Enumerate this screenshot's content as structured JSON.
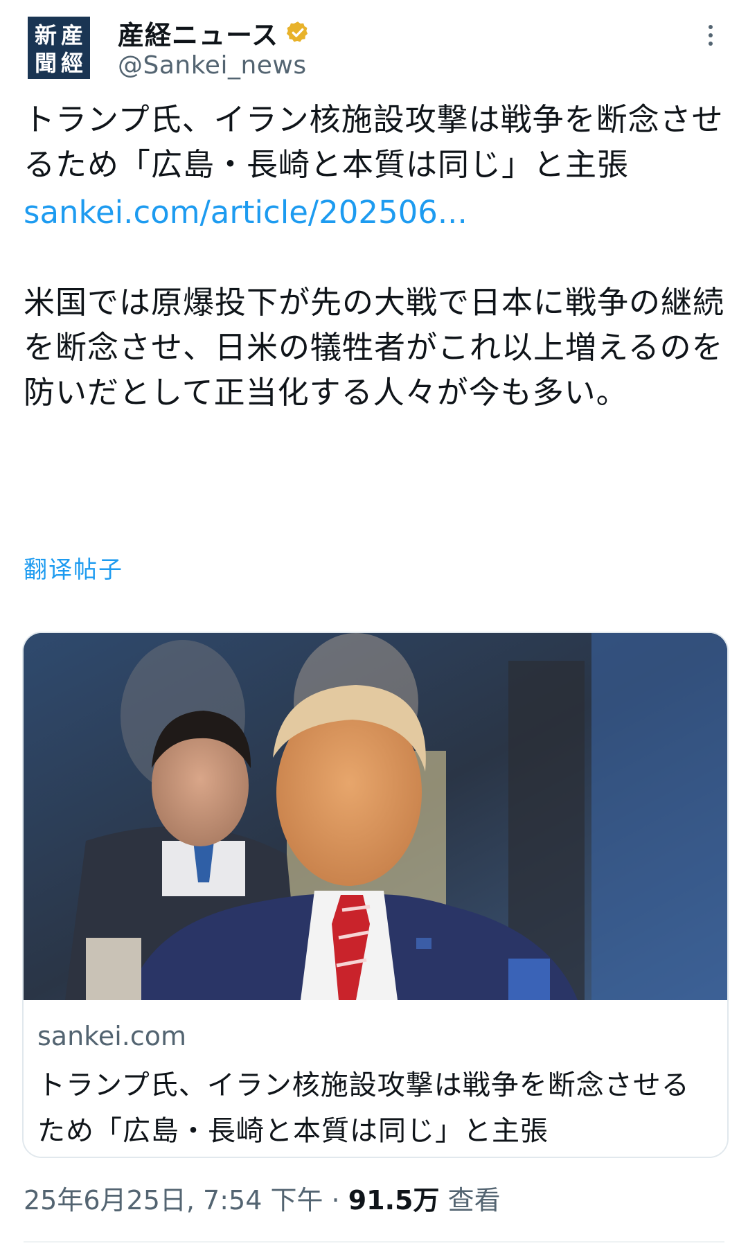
{
  "account": {
    "display_name": "産経ニュース",
    "handle": "@Sankei_news",
    "avatar_glyphs": [
      "産",
      "經",
      "新",
      "聞"
    ],
    "verified_color": "#e8b22a"
  },
  "tweet": {
    "headline": "トランプ氏、イラン核施設攻撃は戦争を断念させるため「広島・長崎と本質は同じ」と主張",
    "link": "sankei.com/article/202506...",
    "body": "米国では原爆投下が先の大戦で日本に戦争の継続を断念させ、日米の犠牲者がこれ以上増えるのを防いだとして正当化する人々が今も多い。",
    "translate_label": "翻译帖子"
  },
  "card": {
    "domain": "sankei.com",
    "title": "トランプ氏、イラン核施設攻撃は戦争を断念させるため「広島・長崎と本質は同じ」と主張"
  },
  "meta": {
    "timestamp": "25年6月25日, 7:54 下午",
    "separator": " · ",
    "views_count": "91.5万",
    "views_label": " 查看"
  },
  "colors": {
    "link": "#1d9bf0",
    "secondary_text": "#536471",
    "primary_text": "#0f1419",
    "card_border": "#e1e8ed"
  }
}
